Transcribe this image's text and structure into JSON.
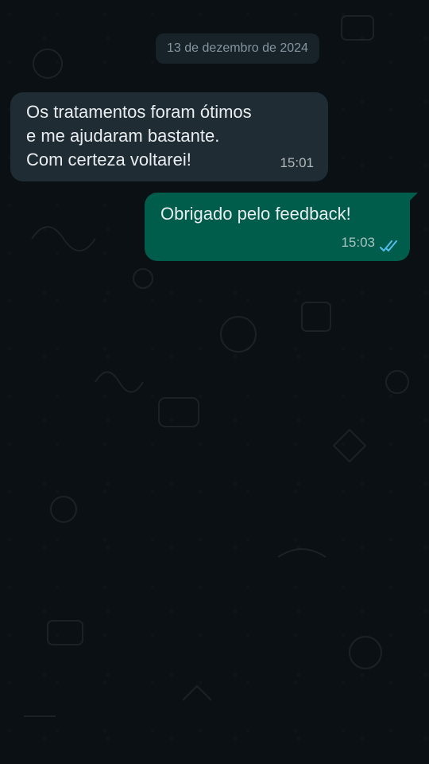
{
  "date_separator": "13 de dezembro de 2024",
  "messages": [
    {
      "direction": "incoming",
      "lines": [
        "Os tratamentos foram ótimos",
        "e me ajudaram bastante.",
        "Com certeza voltarei!"
      ],
      "time": "15:01"
    },
    {
      "direction": "outgoing",
      "lines": [
        "Obrigado pelo feedback!"
      ],
      "time": "15:03",
      "status_icon": "double-check-read-icon"
    }
  ],
  "colors": {
    "background": "#0b1014",
    "incoming_bubble": "#1f2c34",
    "outgoing_bubble": "#005c4b",
    "read_ticks": "#53bdeb",
    "date_chip": "#182229"
  }
}
